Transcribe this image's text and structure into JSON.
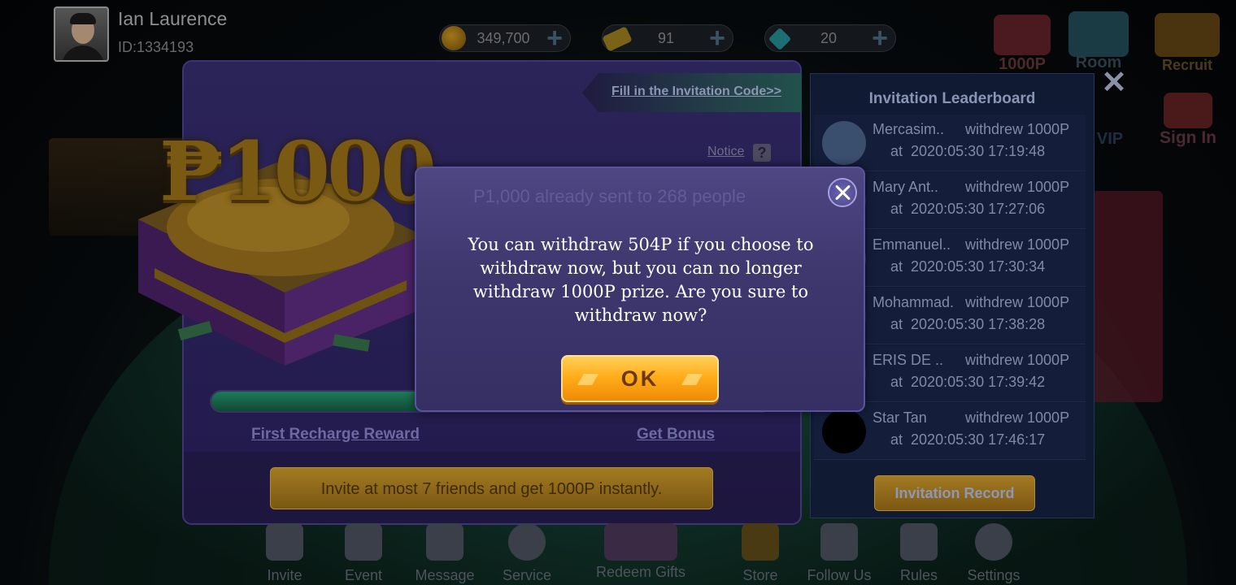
{
  "user": {
    "name": "Ian Laurence",
    "id": "ID:1334193"
  },
  "currencies": {
    "coins": "349,700",
    "tickets": "91",
    "gems": "20"
  },
  "top_right": {
    "item1": "1000P",
    "item2": "Room",
    "item3": "Recruit",
    "vip": "VIP",
    "signin": "Sign In"
  },
  "invitation": {
    "fill_code": "Fill in the Invitation Code>>",
    "notice": "Notice",
    "notice_q": "?",
    "prize": "₱1000",
    "first_recharge": "First Recharge Reward",
    "get_bonus": "Get Bonus",
    "invite_bar": "Invite at most 7 friends and get 1000P instantly.",
    "progress": 0.43
  },
  "leaderboard": {
    "title": "Invitation Leaderboard",
    "rows": [
      {
        "name": "Mercasim..",
        "action": "withdrew 1000P",
        "at": "at",
        "time": "2020:05:30 17:19:48"
      },
      {
        "name": "Mary Ant..",
        "action": "withdrew 1000P",
        "at": "at",
        "time": "2020:05:30 17:27:06"
      },
      {
        "name": "Emmanuel..",
        "action": "withdrew 1000P",
        "at": "at",
        "time": "2020:05:30 17:30:34"
      },
      {
        "name": "Mohammad.",
        "action": "withdrew 1000P",
        "at": "at",
        "time": "2020:05:30 17:38:28"
      },
      {
        "name": "ERIS DE ..",
        "action": "withdrew 1000P",
        "at": "at",
        "time": "2020:05:30 17:39:42"
      },
      {
        "name": "Star Tan",
        "action": "withdrew 1000P",
        "at": "at",
        "time": "2020:05:30 17:46:17"
      }
    ],
    "button": "Invitation Record"
  },
  "modal": {
    "ghost_text": "P1,000 already sent to 268 people",
    "message": "You can withdraw 504P if you choose to withdraw now, but you can no longer withdraw 1000P prize. Are you sure to withdraw now?",
    "ok": "OK"
  },
  "bottom_nav": [
    "Invite",
    "Event",
    "Message",
    "Service",
    "Redeem Gifts",
    "Store",
    "Follow Us",
    "Rules",
    "Settings"
  ],
  "colors": {
    "ok_button": "#ffae1a",
    "modal_bg": "#3e376e",
    "progress_fill": "#1f7a58"
  }
}
